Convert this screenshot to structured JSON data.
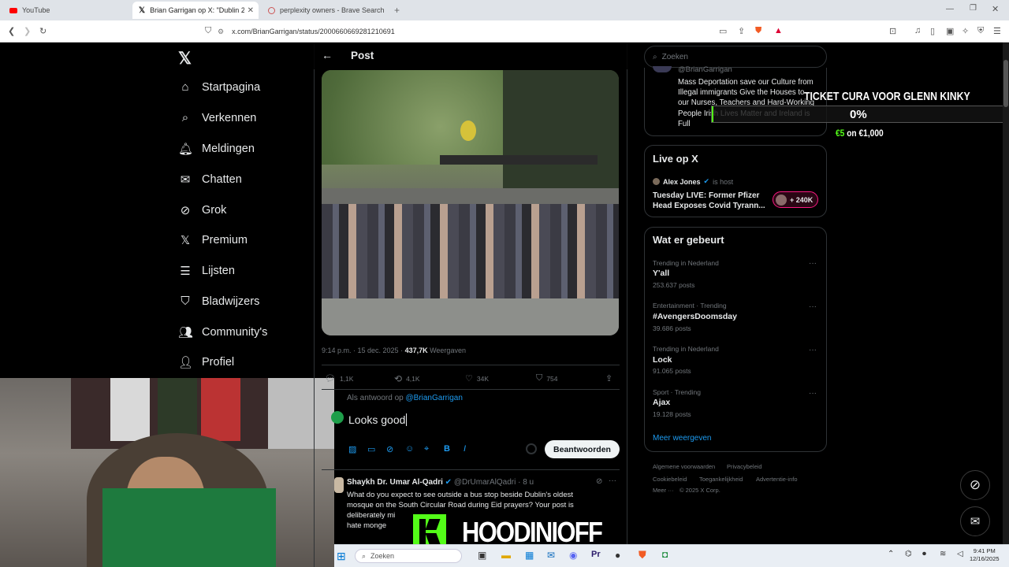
{
  "browser": {
    "tabs": [
      {
        "label": "YouTube"
      },
      {
        "label": "Brian Garrigan op X: \"Dublin 202"
      },
      {
        "label": "perplexity owners - Brave Search"
      }
    ],
    "url": "x.com/BrianGarrigan/status/2000660669281210691"
  },
  "sidebar": {
    "items": [
      {
        "label": "Startpagina",
        "icon": "home-icon"
      },
      {
        "label": "Verkennen",
        "icon": "search-icon"
      },
      {
        "label": "Meldingen",
        "icon": "bell-icon"
      },
      {
        "label": "Chatten",
        "icon": "mail-icon"
      },
      {
        "label": "Grok",
        "icon": "grok-icon"
      },
      {
        "label": "Premium",
        "icon": "x-logo-icon"
      },
      {
        "label": "Lijsten",
        "icon": "list-icon"
      },
      {
        "label": "Bladwijzers",
        "icon": "bookmark-icon"
      },
      {
        "label": "Community's",
        "icon": "community-icon"
      },
      {
        "label": "Profiel",
        "icon": "profile-icon"
      }
    ]
  },
  "post": {
    "header": "Post",
    "meta_time": "9:14 p.m. · 15 dec. 2025 · ",
    "views_count": "437,7K",
    "views_label": " Weergaven",
    "replies": "1,1K",
    "reposts": "4,1K",
    "likes": "34K",
    "bookmarks": "754",
    "reply_to_prefix": "Als antwoord op ",
    "reply_to_handle": "@BrianGarrigan",
    "reply_text": "Looks good",
    "reply_button": "Beantwoorden"
  },
  "next_post": {
    "name": "Shaykh Dr. Umar Al-Qadri",
    "handle": "@DrUmarAlQadri · 8 u",
    "text_line1": "What do you expect to see outside a bus stop beside Dublin's oldest",
    "text_line2": "mosque on the South Circular Road during Eid prayers? Your post is",
    "text_line3": "deliberately mi",
    "text_line4": "hate monge"
  },
  "right": {
    "search_placeholder": "Zoeken",
    "profile_handle": "@BrianGarrigan",
    "profile_bio": "Mass Deportation save our Culture from Illegal immigrants Give the Houses to our Nurses, Teachers and Hard-Working People Irish Lives Matter and Ireland is Full",
    "live_title": "Live op X",
    "live_host_name": "Alex Jones",
    "live_host_suffix": " is host",
    "live_stream_title_1": "Tuesday LIVE: Former Pfizer",
    "live_stream_title_2": "Head Exposes Covid Tyrann...",
    "live_listeners": "+ 240K",
    "trending_title": "Wat er gebeurt",
    "trends": [
      {
        "meta": "Trending in Nederland",
        "title": "Y'all",
        "count": "253.637 posts"
      },
      {
        "meta": "Entertainment · Trending",
        "title": "#AvengersDoomsday",
        "count": "39.686 posts"
      },
      {
        "meta": "Trending in Nederland",
        "title": "Lock",
        "count": "91.065 posts"
      },
      {
        "meta": "Sport · Trending",
        "title": "Ajax",
        "count": "19.128 posts"
      }
    ],
    "more": "Meer weergeven",
    "footer": [
      "Algemene voorwaarden",
      "Privacybeleid",
      "Cookiebeleid",
      "Toegankelijkheid",
      "Advertentie-info",
      "Meer ···",
      "© 2025 X Corp."
    ]
  },
  "overlay": {
    "ticket_title": "TICKET CURA VOOR GLENN KINKY",
    "ticket_percent": "0%",
    "ticket_amount_prefix": "€5",
    "ticket_amount_suffix": " on €1,000",
    "streamer_name": "HOODINIOFF"
  },
  "taskbar": {
    "search": "Zoeken",
    "time": "9:41 PM",
    "date": "12/16/2025"
  },
  "colors": {
    "accent": "#1d9bf0",
    "live": "#f91880",
    "green": "#53fc18"
  }
}
